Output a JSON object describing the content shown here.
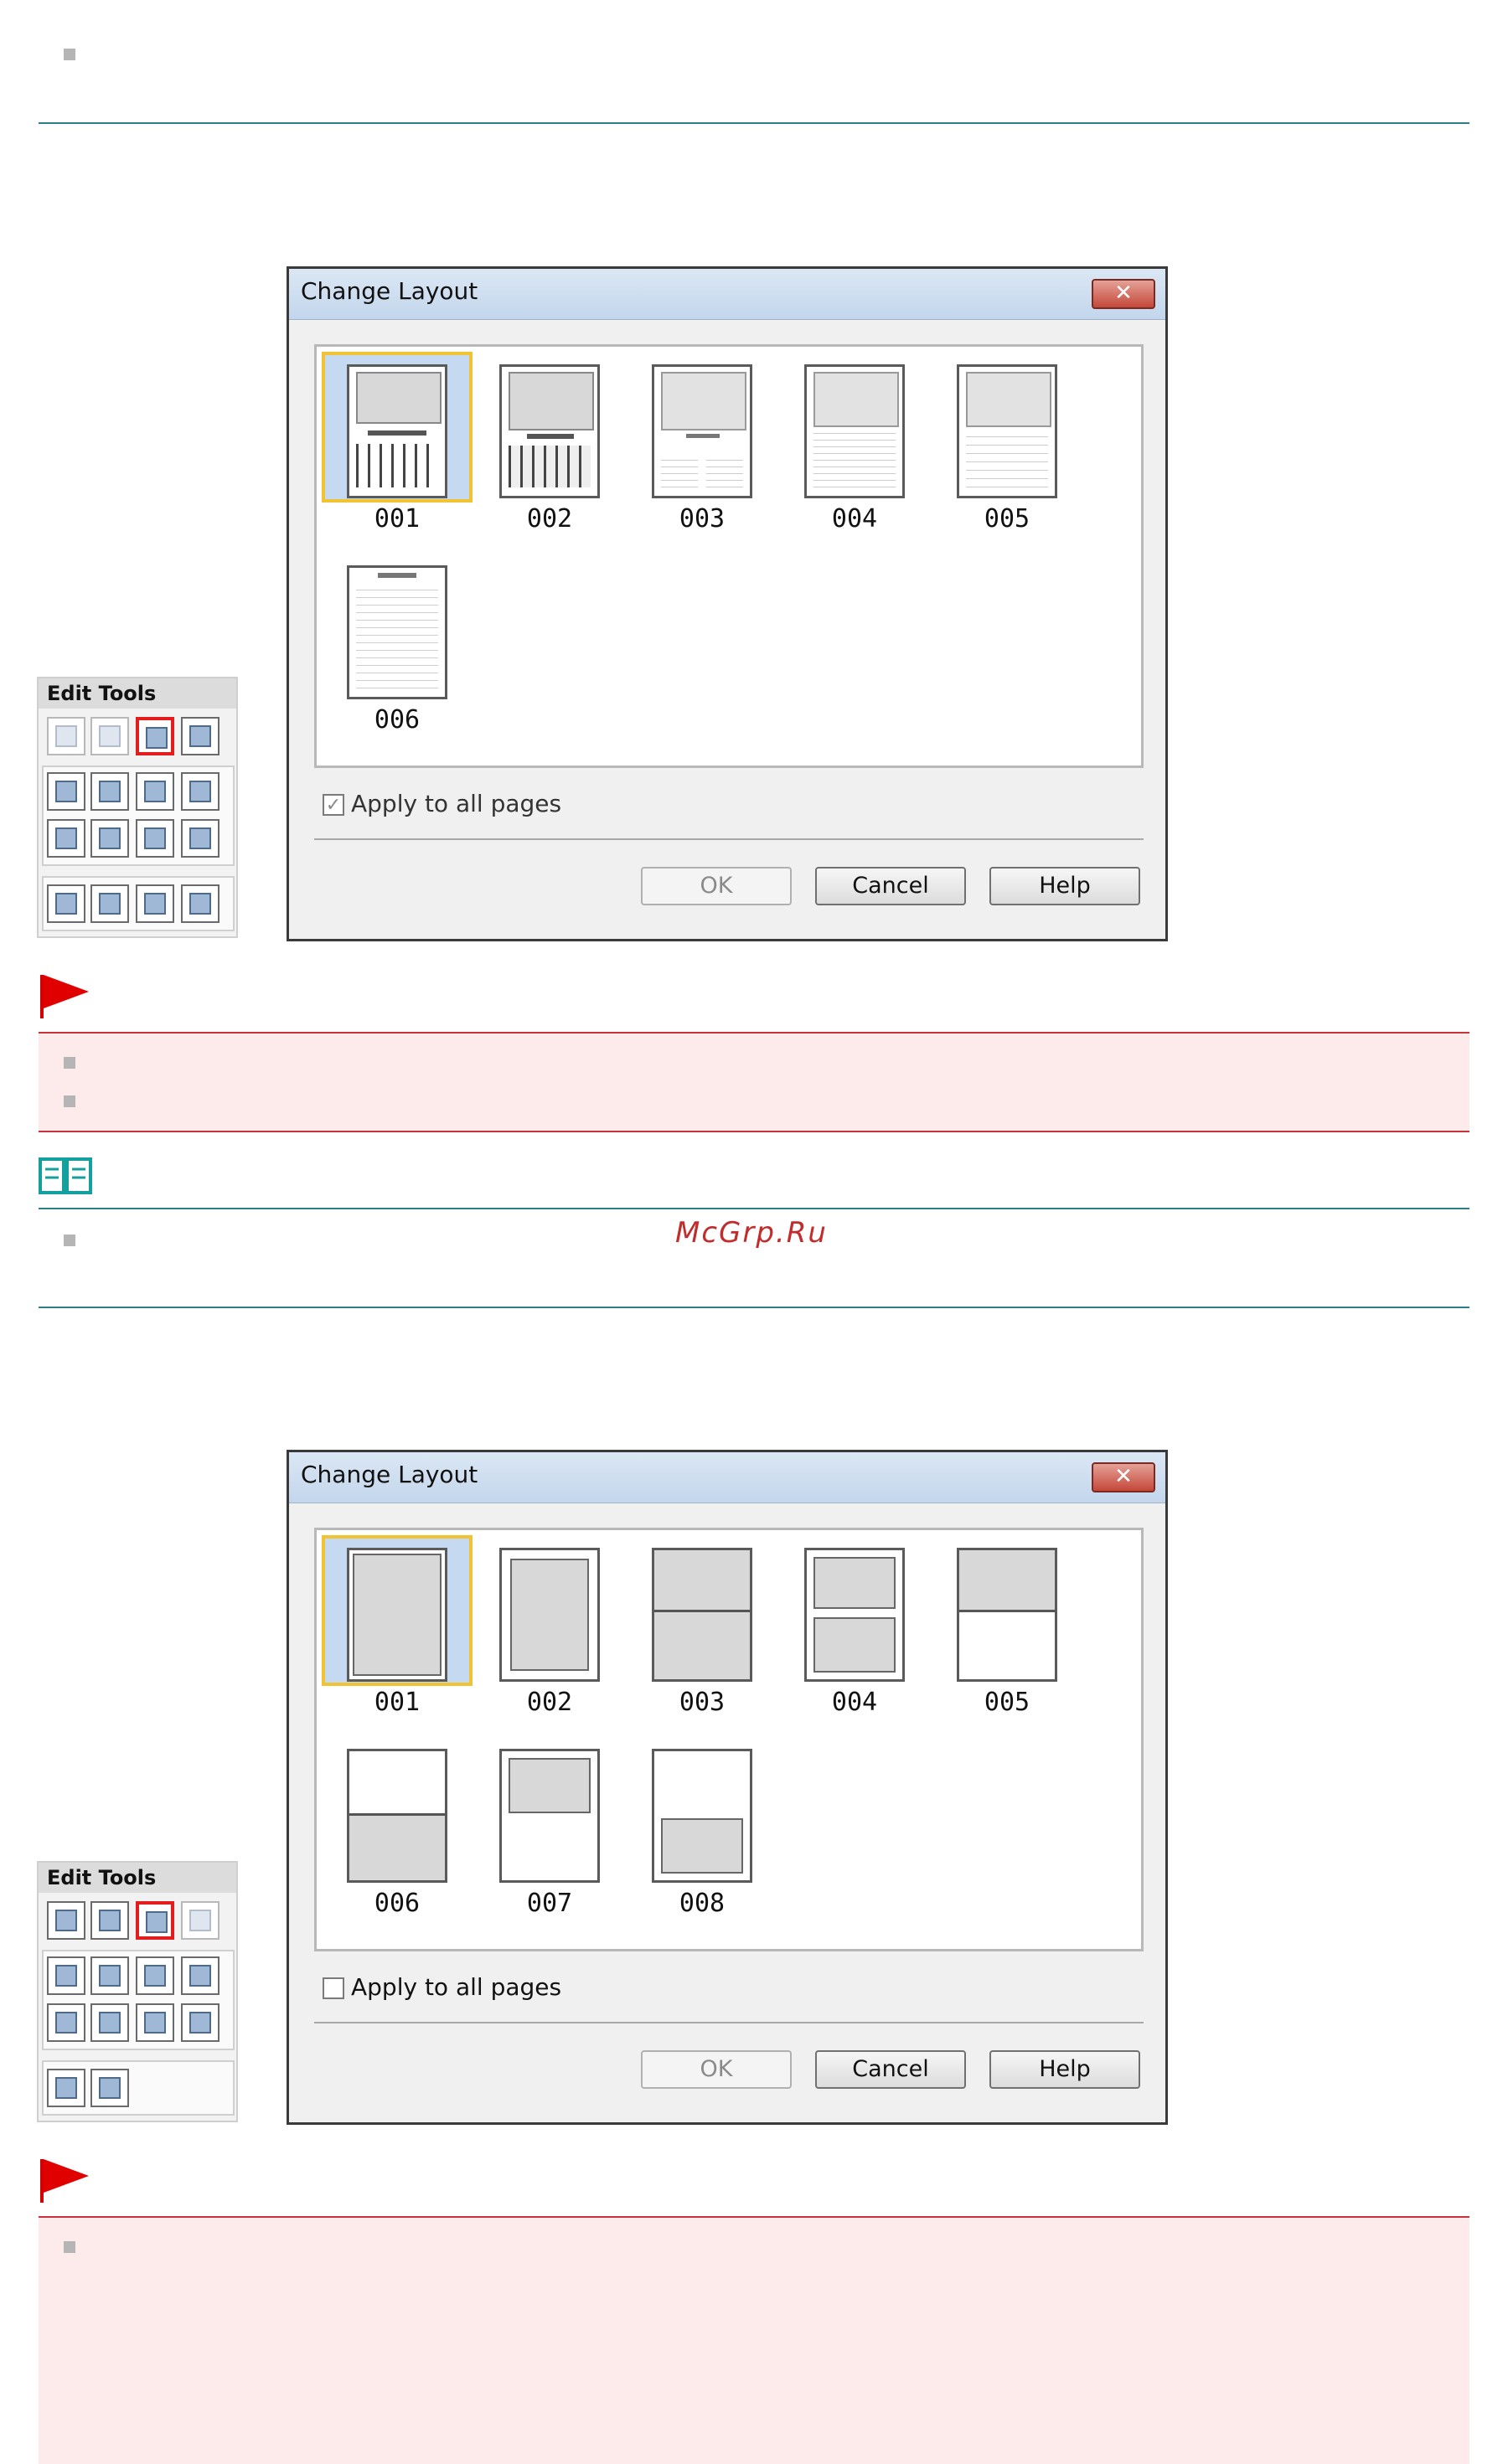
{
  "watermark": "McGrp.Ru",
  "colors": {
    "teal_rule": "#2c7f86",
    "red_rule": "#c7333a",
    "note_bg": "#fdeaea",
    "selection": "#f1c232"
  },
  "dialogs": [
    {
      "title": "Change Layout",
      "close_icon": "close-icon",
      "items": [
        "001",
        "002",
        "003",
        "004",
        "005",
        "006"
      ],
      "selected": "001",
      "apply_all_label": "Apply to all pages",
      "apply_all_checked": true,
      "apply_all_enabled": false,
      "buttons": {
        "ok": "OK",
        "cancel": "Cancel",
        "help": "Help"
      }
    },
    {
      "title": "Change Layout",
      "close_icon": "close-icon",
      "items": [
        "001",
        "002",
        "003",
        "004",
        "005",
        "006",
        "007",
        "008"
      ],
      "selected": "001",
      "apply_all_label": "Apply to all pages",
      "apply_all_checked": false,
      "apply_all_enabled": true,
      "buttons": {
        "ok": "OK",
        "cancel": "Cancel",
        "help": "Help"
      }
    }
  ],
  "tools_palettes": [
    {
      "header": "Edit Tools",
      "highlighted_tool": "change-layout-icon"
    },
    {
      "header": "Edit Tools",
      "highlighted_tool": "change-layout-icon"
    }
  ]
}
